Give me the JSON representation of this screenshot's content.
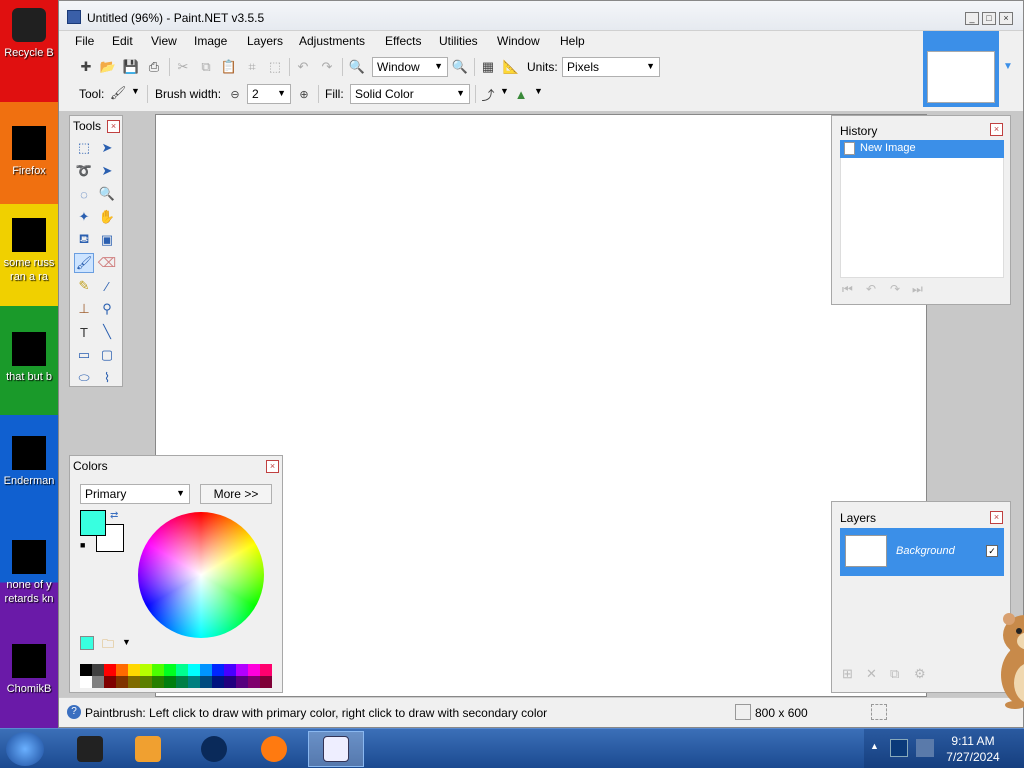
{
  "desktop": {
    "icons": [
      {
        "label": "Recycle B"
      },
      {
        "label": "Firefox"
      },
      {
        "label": "some russ ran a ra"
      },
      {
        "label": "that but b"
      },
      {
        "label": "Enderman"
      },
      {
        "label": "none of y retards kn"
      },
      {
        "label": "ChomikB"
      }
    ]
  },
  "window": {
    "title": "Untitled (96%) - Paint.NET v3.5.5",
    "min": "_",
    "max": "□",
    "close": "×"
  },
  "menu": [
    "File",
    "Edit",
    "View",
    "Image",
    "Layers",
    "Adjustments",
    "Effects",
    "Utilities",
    "Window",
    "Help"
  ],
  "toolbar1": {
    "zoom_value": "Window",
    "units_label": "Units:",
    "units_value": "Pixels"
  },
  "toolbar2": {
    "tool_label": "Tool:",
    "brush_width_label": "Brush width:",
    "brush_width_value": "2",
    "fill_label": "Fill:",
    "fill_value": "Solid Color"
  },
  "tools_panel": {
    "title": "Tools"
  },
  "history_panel": {
    "title": "History",
    "items": [
      "New Image"
    ]
  },
  "colors_panel": {
    "title": "Colors",
    "mode": "Primary",
    "more_label": "More >>",
    "primary_color": "#38ffe0",
    "secondary_color": "#ffffff"
  },
  "layers_panel": {
    "title": "Layers",
    "layers": [
      {
        "name": "Background",
        "visible": true
      }
    ]
  },
  "statusbar": {
    "message": "Paintbrush: Left click to draw with primary color, right click to draw with secondary color",
    "image_size": "800 x 600"
  },
  "taskbar": {
    "time": "9:11 AM",
    "date": "7/27/2024"
  },
  "palette": [
    "#000000",
    "#404040",
    "#ff0000",
    "#ff6a00",
    "#ffd800",
    "#b6ff00",
    "#4cff00",
    "#00ff21",
    "#00ff90",
    "#00ffff",
    "#0094ff",
    "#0026ff",
    "#4800ff",
    "#b200ff",
    "#ff00dc",
    "#ff006e",
    "#ffffff",
    "#808080",
    "#7f0000",
    "#7f3300",
    "#7f6a00",
    "#5b7f00",
    "#267f00",
    "#007f0e",
    "#007f46",
    "#007f7f",
    "#004a7f",
    "#00137f",
    "#21007f",
    "#57007f",
    "#7f006e",
    "#7f0037"
  ]
}
